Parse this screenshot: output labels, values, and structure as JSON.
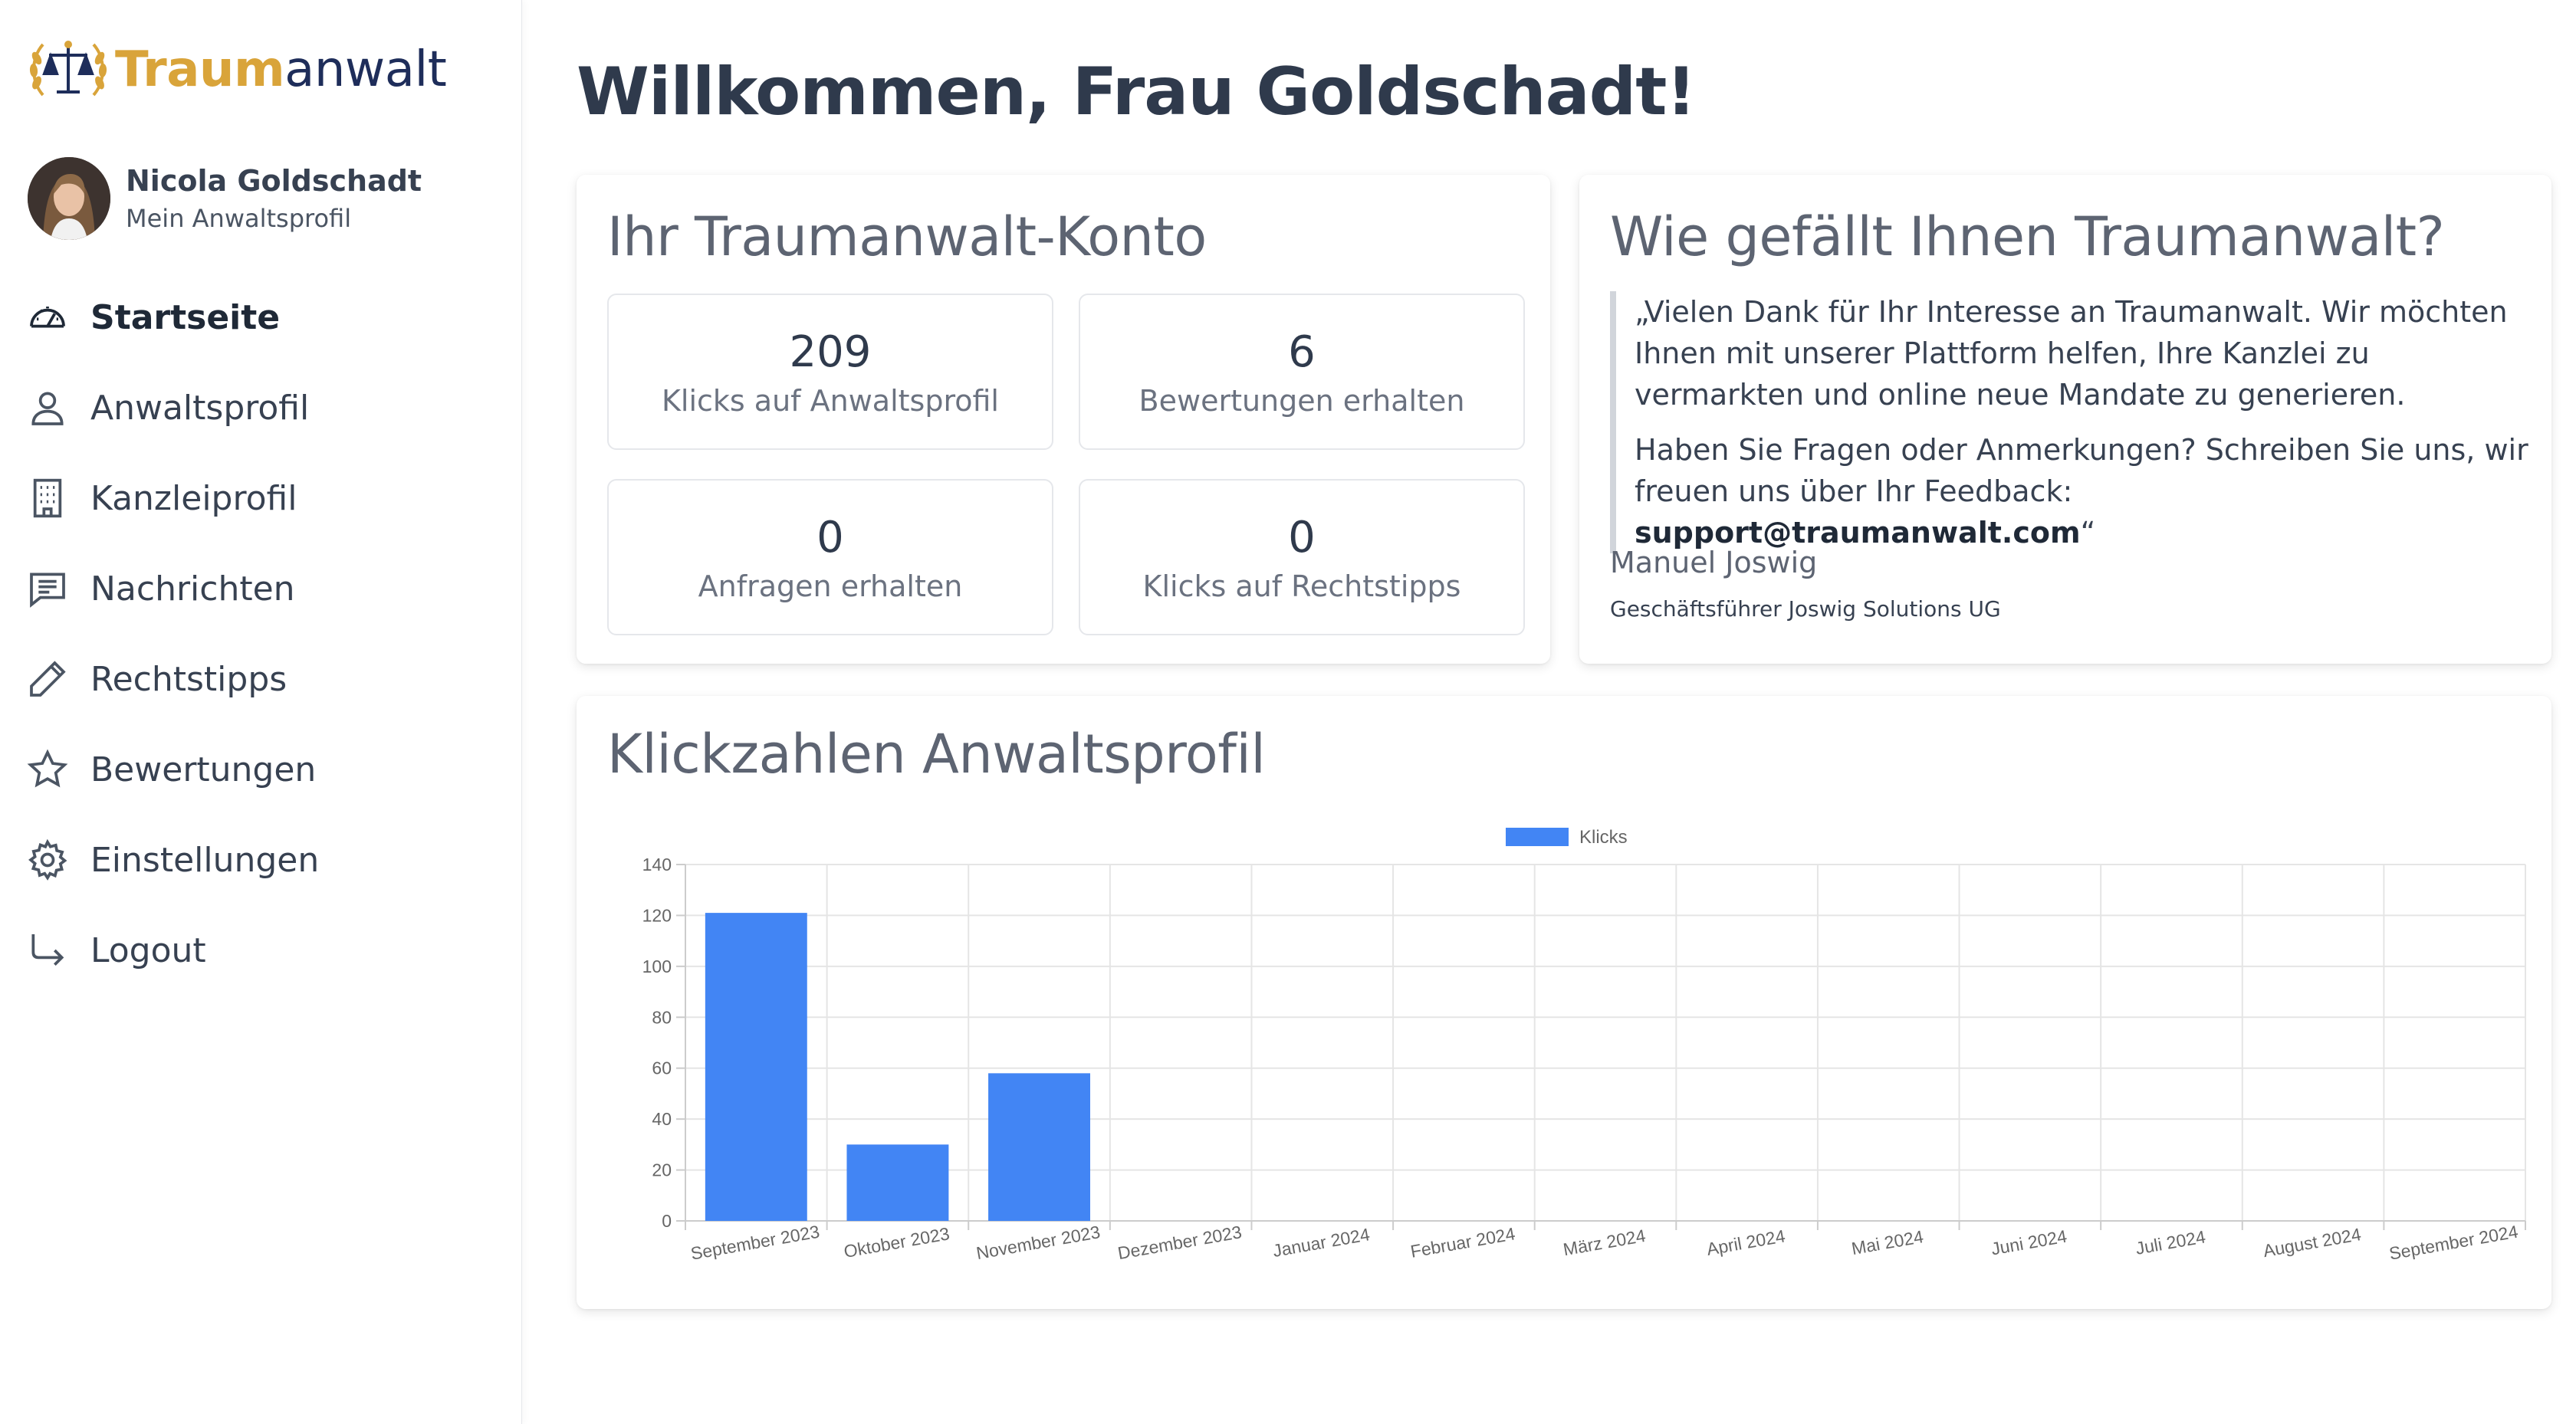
{
  "brand": {
    "part1": "Traum",
    "part2": "anwalt"
  },
  "user": {
    "name": "Nicola Goldschadt",
    "profile_link": "Mein Anwaltsprofil"
  },
  "nav": [
    {
      "label": "Startseite",
      "icon": "dashboard-gauge-icon",
      "active": true
    },
    {
      "label": "Anwaltsprofil",
      "icon": "person-icon"
    },
    {
      "label": "Kanzleiprofil",
      "icon": "building-icon"
    },
    {
      "label": "Nachrichten",
      "icon": "chat-icon"
    },
    {
      "label": "Rechtstipps",
      "icon": "pencil-icon"
    },
    {
      "label": "Bewertungen",
      "icon": "star-icon"
    },
    {
      "label": "Einstellungen",
      "icon": "gear-icon"
    },
    {
      "label": "Logout",
      "icon": "logout-arrow-icon"
    }
  ],
  "page_title": "Willkommen, Frau Goldschadt!",
  "account": {
    "title": "Ihr Traumanwalt-Konto",
    "stats": [
      {
        "value": "209",
        "label": "Klicks auf Anwaltsprofil"
      },
      {
        "value": "6",
        "label": "Bewertungen erhalten"
      },
      {
        "value": "0",
        "label": "Anfragen erhalten"
      },
      {
        "value": "0",
        "label": "Klicks auf Rechtstipps"
      }
    ]
  },
  "feedback": {
    "title": "Wie gefällt Ihnen Traumanwalt?",
    "quote_p1": "„Vielen Dank für Ihr Interesse an Traumanwalt. Wir möchten Ihnen mit unserer Plattform helfen, Ihre Kanzlei zu vermarkten und online neue Mandate zu generieren.",
    "quote_p2_prefix": "Haben Sie Fragen oder Anmerkungen? Schreiben Sie uns, wir freuen uns über Ihr Feedback: ",
    "email": "support@traumanwalt.com",
    "quote_p2_suffix": "“",
    "signer_name": "Manuel Joswig",
    "signer_role": "Geschäftsführer Joswig Solutions UG"
  },
  "chart_section": {
    "title": "Klickzahlen Anwaltsprofil"
  },
  "chart_data": {
    "type": "bar",
    "categories": [
      "September 2023",
      "Oktober 2023",
      "November 2023",
      "Dezember 2023",
      "Januar 2024",
      "Februar 2024",
      "März 2024",
      "April 2024",
      "Mai 2024",
      "Juni 2024",
      "Juli 2024",
      "August 2024",
      "September 2024"
    ],
    "series": [
      {
        "name": "Klicks",
        "values": [
          121,
          30,
          58,
          0,
          0,
          0,
          0,
          0,
          0,
          0,
          0,
          0,
          0
        ],
        "color": "#4285f4"
      }
    ],
    "ylim": [
      0,
      140
    ],
    "yticks": [
      0,
      20,
      40,
      60,
      80,
      100,
      120,
      140
    ],
    "grid": true,
    "legend": "top-center"
  },
  "colors": {
    "accent_gold": "#d9a43a",
    "brand_navy": "#1e2d5a",
    "bar_blue": "#4285f4"
  }
}
